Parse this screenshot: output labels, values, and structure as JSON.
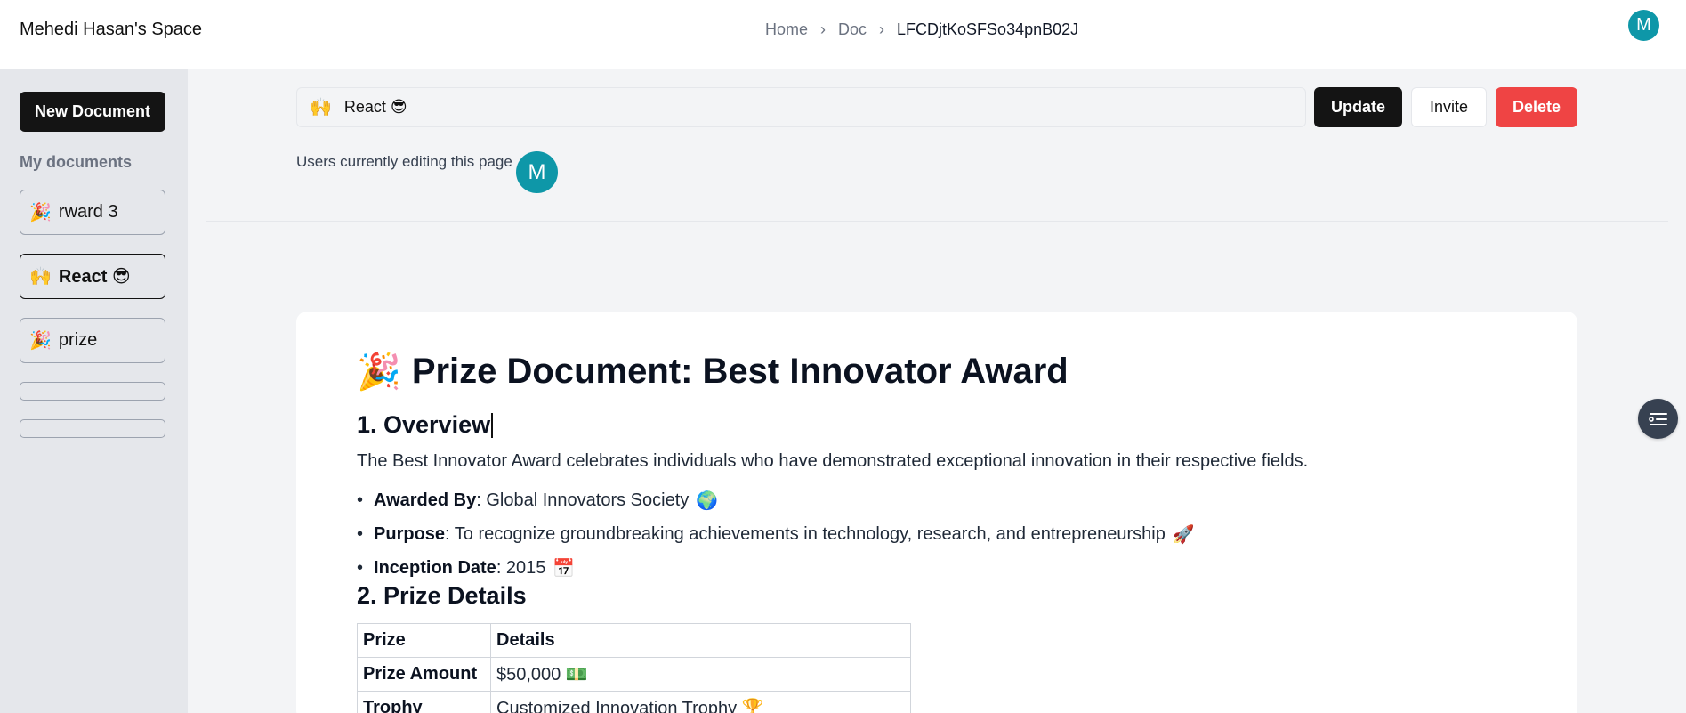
{
  "header": {
    "brand": "Mehedi Hasan's Space",
    "breadcrumb": [
      "Home",
      "Doc",
      "LFCDjtKoSFSo34pnB02J"
    ],
    "avatar_letter": "M"
  },
  "sidebar": {
    "new_document_label": "New Document",
    "section_label": "My documents",
    "items": [
      {
        "emoji": "🎉",
        "label": "rward 3",
        "active": false
      },
      {
        "emoji": "🙌",
        "label": "React 😎",
        "active": true
      },
      {
        "emoji": "🎉",
        "label": "prize",
        "active": false
      }
    ]
  },
  "editor": {
    "title_emoji": "🙌",
    "title_value": "React 😎",
    "update_label": "Update",
    "invite_label": "Invite",
    "delete_label": "Delete",
    "editing_label": "Users currently editing this page",
    "editing_avatar_letter": "M"
  },
  "document": {
    "h1_emoji": "🎉",
    "h1": "Prize Document: Best Innovator Award",
    "h2_overview": "1. Overview",
    "overview_text": "The Best Innovator Award celebrates individuals who have demonstrated exceptional innovation in their respective fields.",
    "bullets": [
      {
        "key": "Awarded By",
        "value": ": Global Innovators Society",
        "emoji": "🌍"
      },
      {
        "key": "Purpose",
        "value": ": To recognize groundbreaking achievements in technology, research, and entrepreneurship",
        "emoji": "🚀"
      },
      {
        "key": "Inception Date",
        "value": ": 2015",
        "emoji": "📅"
      }
    ],
    "h2_details": "2. Prize Details",
    "table": {
      "headers": [
        "Prize",
        "Details"
      ],
      "rows": [
        {
          "prize": "Prize Amount",
          "details": "$50,000",
          "emoji": "💵"
        },
        {
          "prize": "Trophy",
          "details": "Customized Innovation Trophy",
          "emoji": "🏆"
        }
      ]
    }
  },
  "colors": {
    "accent_teal": "#0e97a8",
    "delete_red": "#ef4444",
    "primary_dark": "#141414"
  }
}
